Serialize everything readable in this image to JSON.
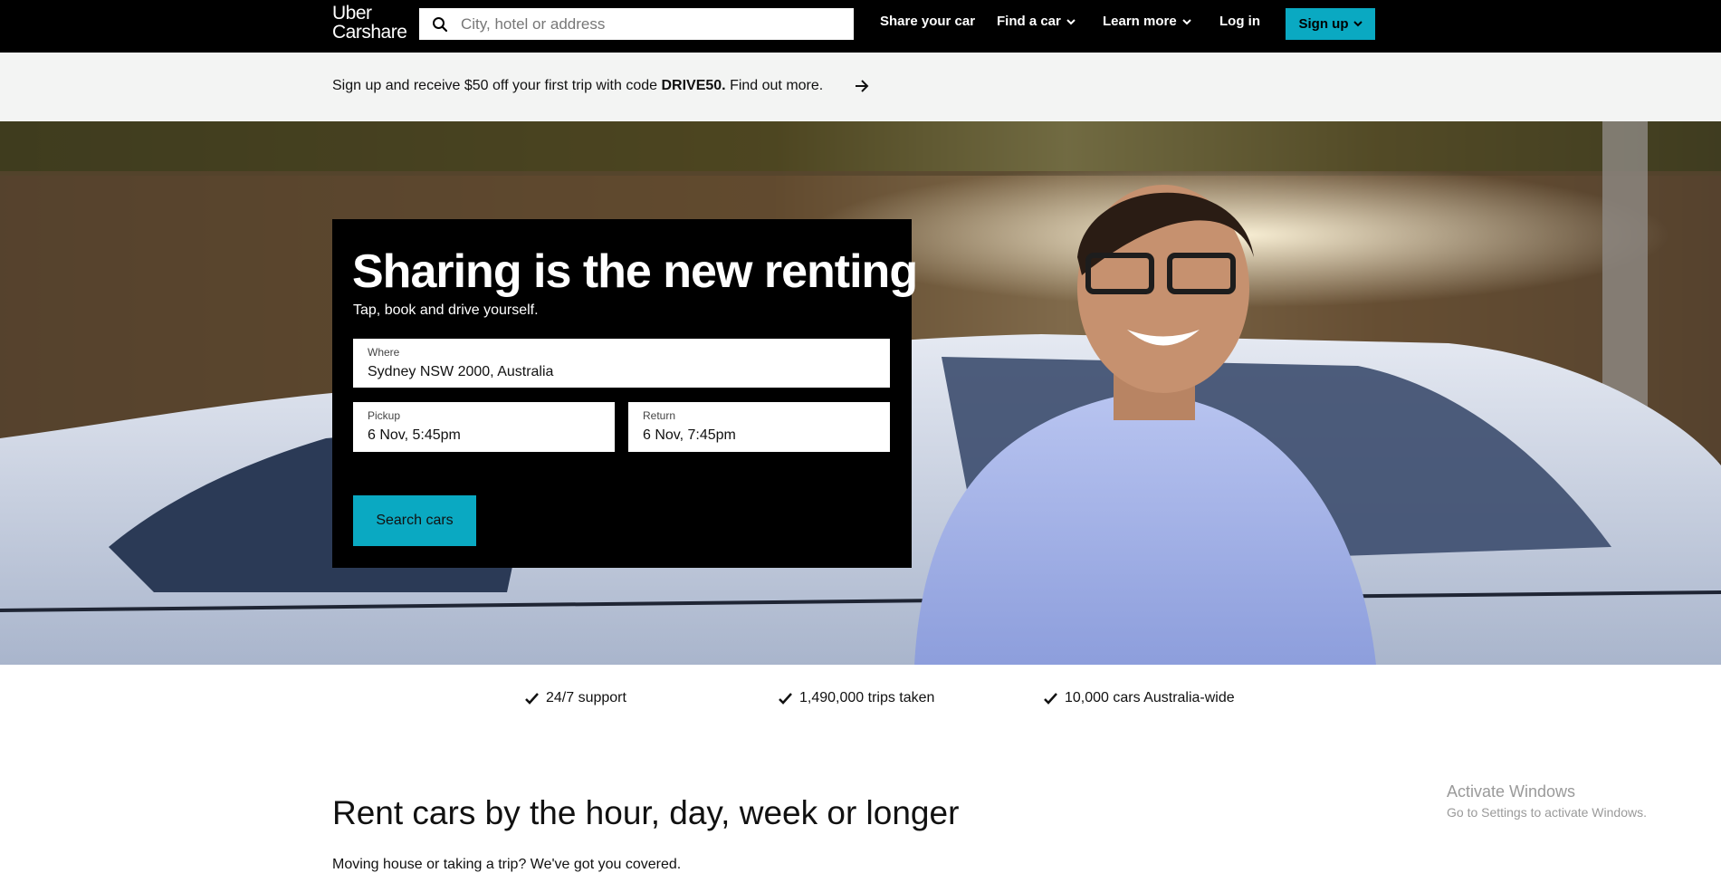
{
  "brand": {
    "line1": "Uber",
    "line2": "Carshare"
  },
  "search": {
    "placeholder": "City, hotel or address",
    "value": ""
  },
  "nav": {
    "share_your_car": "Share your car",
    "find_a_car": "Find a car",
    "learn_more": "Learn more",
    "log_in": "Log in",
    "sign_up": "Sign up"
  },
  "promo": {
    "text_before": "Sign up and receive $50 off your first trip with code ",
    "code": "DRIVE50.",
    "link": "Find out more."
  },
  "hero": {
    "title": "Sharing is the new renting",
    "subtitle": "Tap, book and drive yourself.",
    "where_label": "Where",
    "where_value": "Sydney NSW 2000, Australia",
    "pickup_label": "Pickup",
    "pickup_value": "6 Nov, 5:45pm",
    "return_label": "Return",
    "return_value": "6 Nov, 7:45pm",
    "search_button": "Search cars"
  },
  "features": [
    "24/7 support",
    "1,490,000 trips taken",
    "10,000 cars Australia-wide"
  ],
  "section": {
    "title": "Rent cars by the hour, day, week or longer",
    "description": "Moving house or taking a trip? We've got you covered."
  },
  "watermark": {
    "title": "Activate Windows",
    "subtitle": "Go to Settings to activate Windows."
  },
  "colors": {
    "accent": "#0aa9c2",
    "nav_bg": "#000000",
    "promo_bg": "#f3f4f3"
  }
}
